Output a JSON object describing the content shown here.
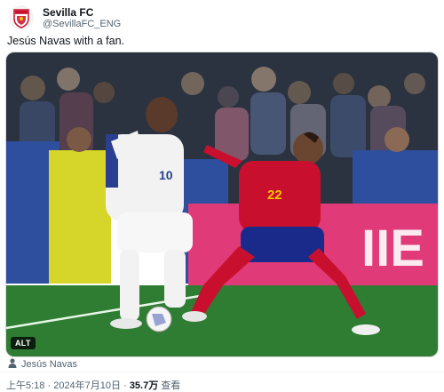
{
  "account": {
    "name": "Sevilla FC",
    "handle": "@SevillaFC_ENG",
    "avatar_icon": "sevilla-crest-icon"
  },
  "tweet": {
    "text": "Jesús Navas with a fan."
  },
  "media": {
    "alt_label": "ALT",
    "player_left_number": "10",
    "player_right_number": "22",
    "board_text": "IIE"
  },
  "tag": {
    "icon": "person-icon",
    "label": "Jesús Navas"
  },
  "meta": {
    "time": "上午5:18",
    "separator": " · ",
    "date": "2024年7月10日",
    "views": "35.7万",
    "views_suffix": " 查看"
  },
  "colors": {
    "handle_gray": "#536471",
    "spain_red": "#c8102e",
    "france_white": "#f2f2f2",
    "pitch_green": "#2e7d32"
  }
}
